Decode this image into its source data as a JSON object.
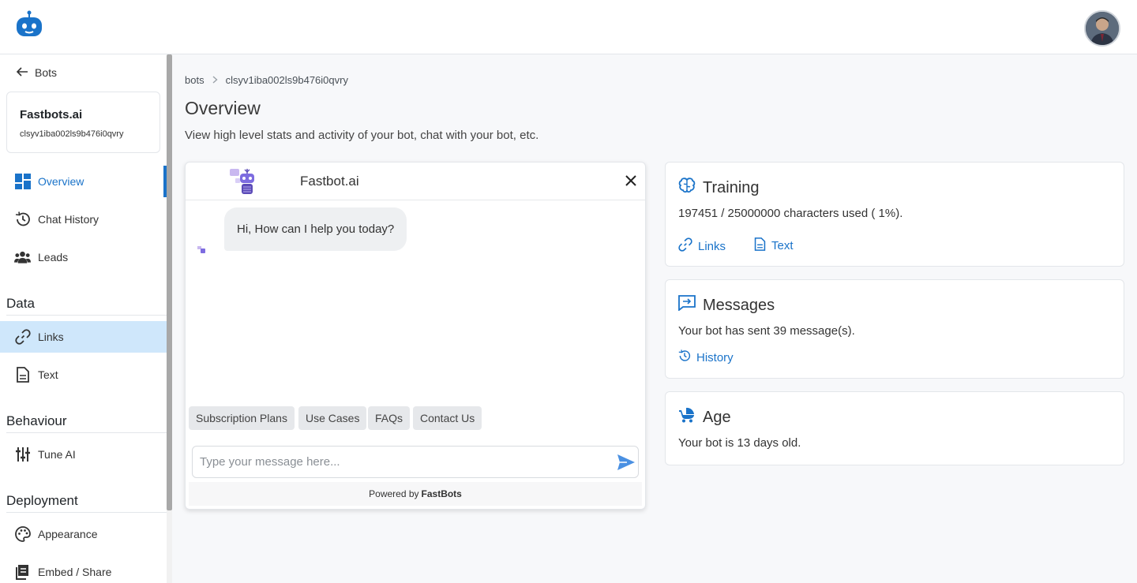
{
  "colors": {
    "accent": "#1a73c9",
    "active_bg": "#cfe7fb",
    "page_bg": "#f7f8fa"
  },
  "sidebar": {
    "back_label": "Bots",
    "bot_name": "Fastbots.ai",
    "bot_id": "clsyv1iba002ls9b476i0qvry",
    "items": [
      {
        "label": "Overview",
        "icon": "dashboard-icon"
      },
      {
        "label": "Chat History",
        "icon": "history-icon"
      },
      {
        "label": "Leads",
        "icon": "people-icon"
      }
    ],
    "sections": {
      "data": {
        "title": "Data",
        "items": [
          {
            "label": "Links",
            "icon": "link-icon"
          },
          {
            "label": "Text",
            "icon": "document-icon"
          }
        ]
      },
      "behaviour": {
        "title": "Behaviour",
        "items": [
          {
            "label": "Tune AI",
            "icon": "sliders-icon"
          }
        ]
      },
      "deployment": {
        "title": "Deployment",
        "items": [
          {
            "label": "Appearance",
            "icon": "palette-icon"
          },
          {
            "label": "Embed / Share",
            "icon": "embed-icon"
          }
        ]
      }
    }
  },
  "breadcrumb": {
    "root": "bots",
    "current": "clsyv1iba002ls9b476i0qvry"
  },
  "page": {
    "title": "Overview",
    "subtitle": "View high level stats and activity of your bot, chat with your bot, etc."
  },
  "chat": {
    "title": "Fastbot.ai",
    "greeting": "Hi, How can I help you today?",
    "quick_replies": [
      "Subscription Plans",
      "Use Cases",
      "FAQs",
      "Contact Us"
    ],
    "input_placeholder": "Type your message here...",
    "powered_by_prefix": "Powered by",
    "powered_by_brand": "FastBots"
  },
  "cards": {
    "training": {
      "title": "Training",
      "usage": "197451 / 25000000 characters used ( 1%).",
      "links_label": "Links",
      "text_label": "Text"
    },
    "messages": {
      "title": "Messages",
      "summary": "Your bot has sent 39 message(s).",
      "history_label": "History"
    },
    "age": {
      "title": "Age",
      "summary": "Your bot is 13 days old."
    }
  }
}
